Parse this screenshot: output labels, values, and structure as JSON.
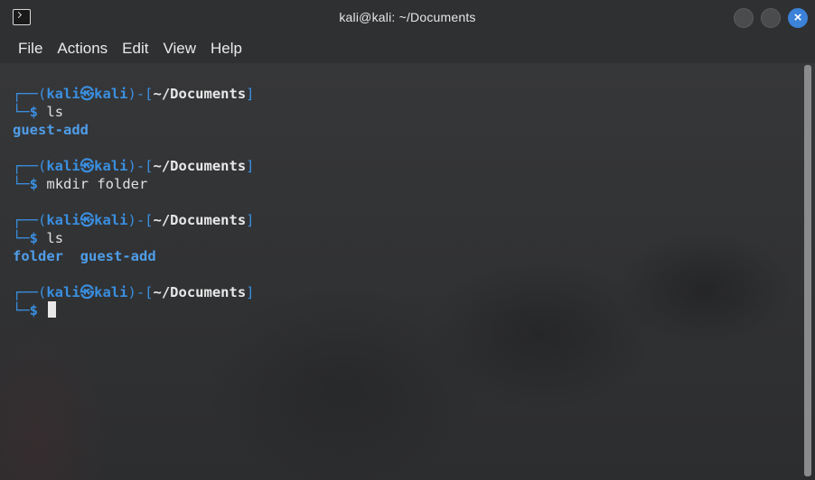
{
  "window": {
    "title": "kali@kali: ~/Documents",
    "close_glyph": "×",
    "buttons": [
      "minimize-icon",
      "maximize-icon",
      "close-icon"
    ]
  },
  "menu": [
    "File",
    "Actions",
    "Edit",
    "View",
    "Help"
  ],
  "terminal": {
    "blocks": [
      {
        "user": "kali",
        "at": "㉿",
        "host": "kali",
        "path": "~/Documents",
        "command": "ls",
        "output": [
          "guest-add"
        ]
      },
      {
        "user": "kali",
        "at": "㉿",
        "host": "kali",
        "path": "~/Documents",
        "command": "mkdir folder",
        "output": []
      },
      {
        "user": "kali",
        "at": "㉿",
        "host": "kali",
        "path": "~/Documents",
        "command": "ls",
        "output": [
          "folder",
          "guest-add"
        ]
      },
      {
        "user": "kali",
        "at": "㉿",
        "host": "kali",
        "path": "~/Documents",
        "command": "",
        "output": []
      }
    ],
    "prompt_top_prefix": "┌──(",
    "prompt_top_close": ")-[",
    "prompt_top_end": "]",
    "prompt_bottom_prefix": "└─",
    "prompt_symbol": "$"
  },
  "colors": {
    "accent": "#3a8fe0",
    "close_button": "#3b82d8",
    "background": "#323335"
  }
}
